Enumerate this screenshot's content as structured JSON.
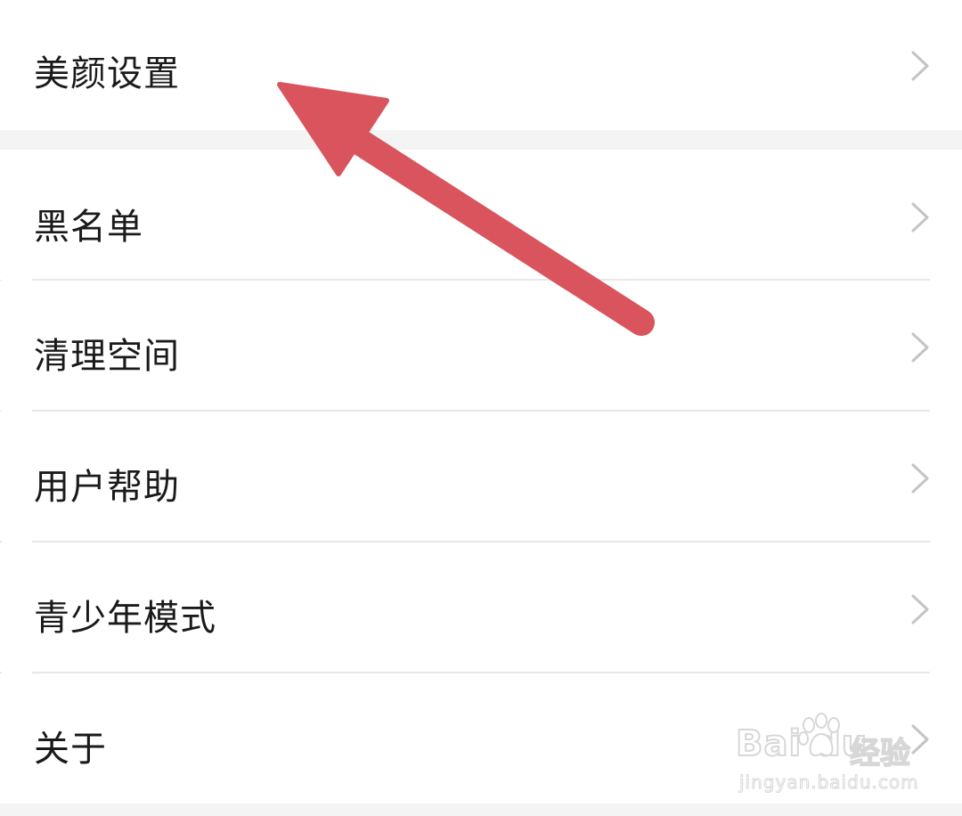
{
  "settings": {
    "items": [
      {
        "label": "美颜设置",
        "icon": "chevron-right-icon"
      },
      {
        "label": "黑名单",
        "icon": "chevron-right-icon"
      },
      {
        "label": "清理空间",
        "icon": "chevron-right-icon"
      },
      {
        "label": "用户帮助",
        "icon": "chevron-right-icon"
      },
      {
        "label": "青少年模式",
        "icon": "chevron-right-icon"
      },
      {
        "label": "关于",
        "icon": "chevron-right-icon"
      }
    ]
  },
  "annotation": {
    "arrow_color": "#d9545c",
    "points_to": "美颜设置"
  },
  "watermark": {
    "brand": "Bai du",
    "name": "经验",
    "url": "jingyan.baidu.com"
  },
  "colors": {
    "background": "#ffffff",
    "section_gap": "#f4f4f4",
    "divider": "#e8e8e8",
    "text": "#1a1a1a",
    "chevron": "#c4c4c4"
  }
}
